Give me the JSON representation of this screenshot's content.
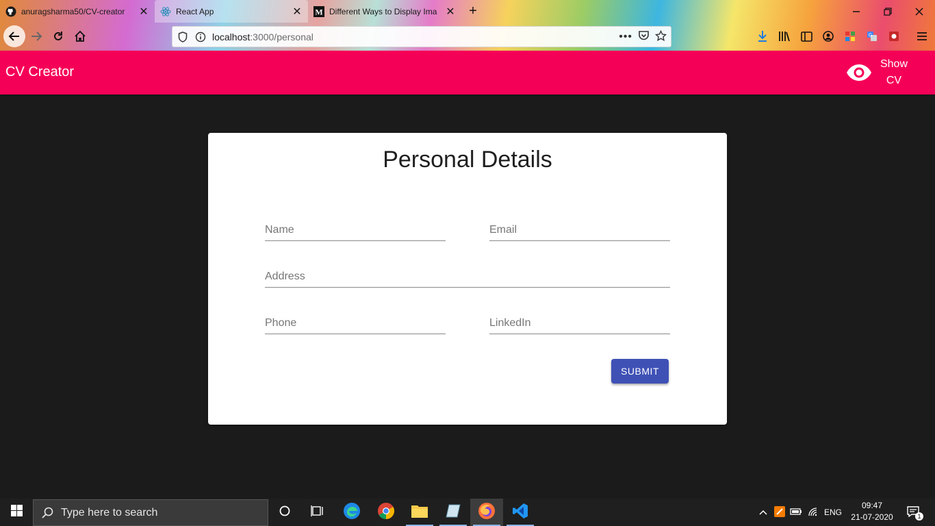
{
  "browser": {
    "tabs": [
      {
        "title": "anuragsharma50/CV-creator",
        "favicon": "github-icon"
      },
      {
        "title": "React App",
        "favicon": "react-icon"
      },
      {
        "title": "Different Ways to Display Ima",
        "favicon": "medium-icon"
      }
    ],
    "url_host": "localhost",
    "url_path": ":3000/personal"
  },
  "app": {
    "title": "CV Creator",
    "show_cv_label": "Show CV",
    "brand_color": "#f50057"
  },
  "form": {
    "title": "Personal Details",
    "fields": {
      "name": "Name",
      "email": "Email",
      "address": "Address",
      "phone": "Phone",
      "linkedin": "LinkedIn"
    },
    "submit_label": "SUBMIT",
    "submit_color": "#3f51b5"
  },
  "taskbar": {
    "search_placeholder": "Type here to search",
    "language": "ENG",
    "time": "09:47",
    "date": "21-07-2020",
    "notifications": "1"
  }
}
